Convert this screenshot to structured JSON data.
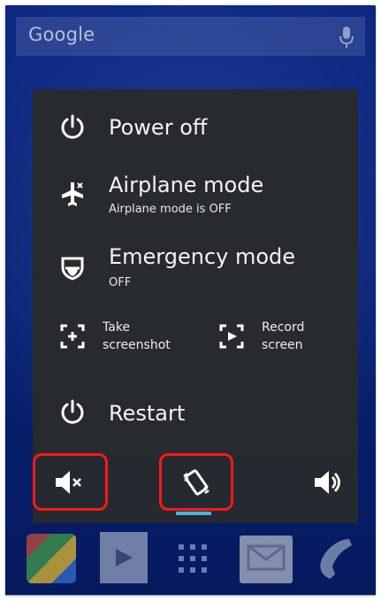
{
  "search": {
    "label": "Google"
  },
  "menu": {
    "power_off": {
      "title": "Power off"
    },
    "airplane": {
      "title": "Airplane mode",
      "status": "Airplane mode is OFF"
    },
    "emergency": {
      "title": "Emergency mode",
      "status": "OFF"
    },
    "screenshot": {
      "label": "Take\nscreenshot"
    },
    "record": {
      "label": "Record\nscreen"
    },
    "restart": {
      "title": "Restart"
    }
  },
  "soundbar": {
    "selected_mode": "vibrate",
    "accent_color": "#46b5e5",
    "highlight_color": "#ff1717",
    "icons": [
      "mute-icon",
      "vibrate-icon",
      "sound-on-icon"
    ]
  },
  "dock": {
    "icons": [
      "app-folder-icon",
      "play-store-icon",
      "app-drawer-icon",
      "email-icon",
      "phone-icon"
    ]
  }
}
